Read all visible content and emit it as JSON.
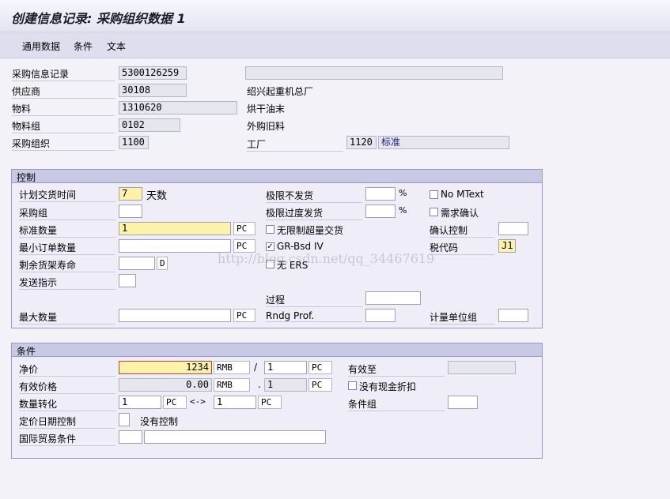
{
  "title": "创建信息记录: 采购组织数据 1",
  "menu": [
    "通用数据",
    "条件",
    "文本"
  ],
  "header": {
    "info_record_label": "采购信息记录",
    "info_record_value": "5300126259",
    "vendor_label": "供应商",
    "vendor_value": "30108",
    "vendor_name": "绍兴起重机总厂",
    "material_label": "物料",
    "material_value": "1310620",
    "material_desc": "烘干油末",
    "material_group_label": "物料组",
    "material_group_value": "0102",
    "material_group_desc": "外购旧料",
    "purch_org_label": "采购组织",
    "purch_org_value": "1100",
    "plant_label": "工厂",
    "plant_value": "1120",
    "plant_desc": "标准"
  },
  "control": {
    "title": "控制",
    "planned_delivery_label": "计划交货时间",
    "planned_delivery_value": "7",
    "planned_delivery_unit": "天数",
    "purch_group_label": "采购组",
    "standard_qty_label": "标准数量",
    "standard_qty_value": "1",
    "standard_qty_unit": "PC",
    "min_order_label": "最小订单数量",
    "min_order_unit": "PC",
    "shelf_life_label": "剩余货架寿命",
    "shelf_life_unit": "D",
    "shipping_instr_label": "发送指示",
    "max_qty_label": "最大数量",
    "max_qty_unit": "PC",
    "underdelivery_label": "极限不发货",
    "underdelivery_unit": "%",
    "overdelivery_label": "极限过度发货",
    "overdelivery_unit": "%",
    "unlimited_label": "无限制超量交货",
    "grbsd_label": "GR-Bsd IV",
    "grbsd_checked": "✓",
    "no_ers_label": "无 ERS",
    "process_label": "过程",
    "rndg_label": "Rndg Prof.",
    "no_mtext_label": "No MText",
    "ack_req_label": "需求确认",
    "conf_ctrl_label": "确认控制",
    "tax_code_label": "税代码",
    "tax_code_value": "J1",
    "unit_group_label": "计量单位组"
  },
  "conditions": {
    "title": "条件",
    "net_price_label": "净价",
    "net_price_value": "1234",
    "net_price_currency": "RMB",
    "slash": "/",
    "price_unit_value": "1",
    "price_unit_uom": "PC",
    "valid_to_label": "有效至",
    "eff_price_label": "有效价格",
    "eff_price_value": "0.00",
    "eff_price_currency": "RMB",
    "eff_dot": ".",
    "eff_unit_value": "1",
    "eff_unit_uom": "PC",
    "no_cash_disc_label": "没有现金折扣",
    "qty_conv_label": "数量转化",
    "qty_conv_left": "1",
    "qty_conv_left_uom": "PC",
    "qty_conv_arrow": "<->",
    "qty_conv_right": "1",
    "qty_conv_right_uom": "PC",
    "cond_group_label": "条件组",
    "price_date_label": "定价日期控制",
    "price_date_text": "没有控制",
    "incoterms_label": "国际贸易条件"
  },
  "watermark": "http://blog.csdn.net/qq_34467619"
}
